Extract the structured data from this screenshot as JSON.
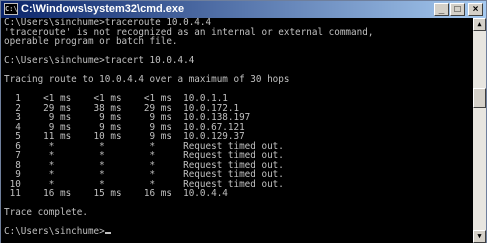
{
  "window": {
    "title": "C:\\Windows\\system32\\cmd.exe",
    "icon_text": "C:\\",
    "buttons": {
      "minimize": "_",
      "maximize": "□",
      "close": "×"
    }
  },
  "scrollbar": {
    "up_arrow": "▲",
    "down_arrow": "▼"
  },
  "console": {
    "lines": [
      "C:\\Users\\sinchume>traceroute 10.0.4.4",
      "'traceroute' is not recognized as an internal or external command,",
      "operable program or batch file.",
      "",
      "C:\\Users\\sinchume>tracert 10.0.4.4",
      "",
      "Tracing route to 10.0.4.4 over a maximum of 30 hops",
      "",
      "  1    <1 ms    <1 ms    <1 ms  10.0.1.1",
      "  2    29 ms    38 ms    29 ms  10.0.172.1",
      "  3     9 ms     9 ms     9 ms  10.0.138.197",
      "  4     9 ms     9 ms     9 ms  10.0.67.121",
      "  5    11 ms    10 ms     9 ms  10.0.129.37",
      "  6     *        *        *     Request timed out.",
      "  7     *        *        *     Request timed out.",
      "  8     *        *        *     Request timed out.",
      "  9     *        *        *     Request timed out.",
      " 10     *        *        *     Request timed out.",
      " 11    16 ms    15 ms    16 ms  10.0.4.4",
      "",
      "Trace complete.",
      ""
    ],
    "prompt": "C:\\Users\\sinchume>"
  }
}
